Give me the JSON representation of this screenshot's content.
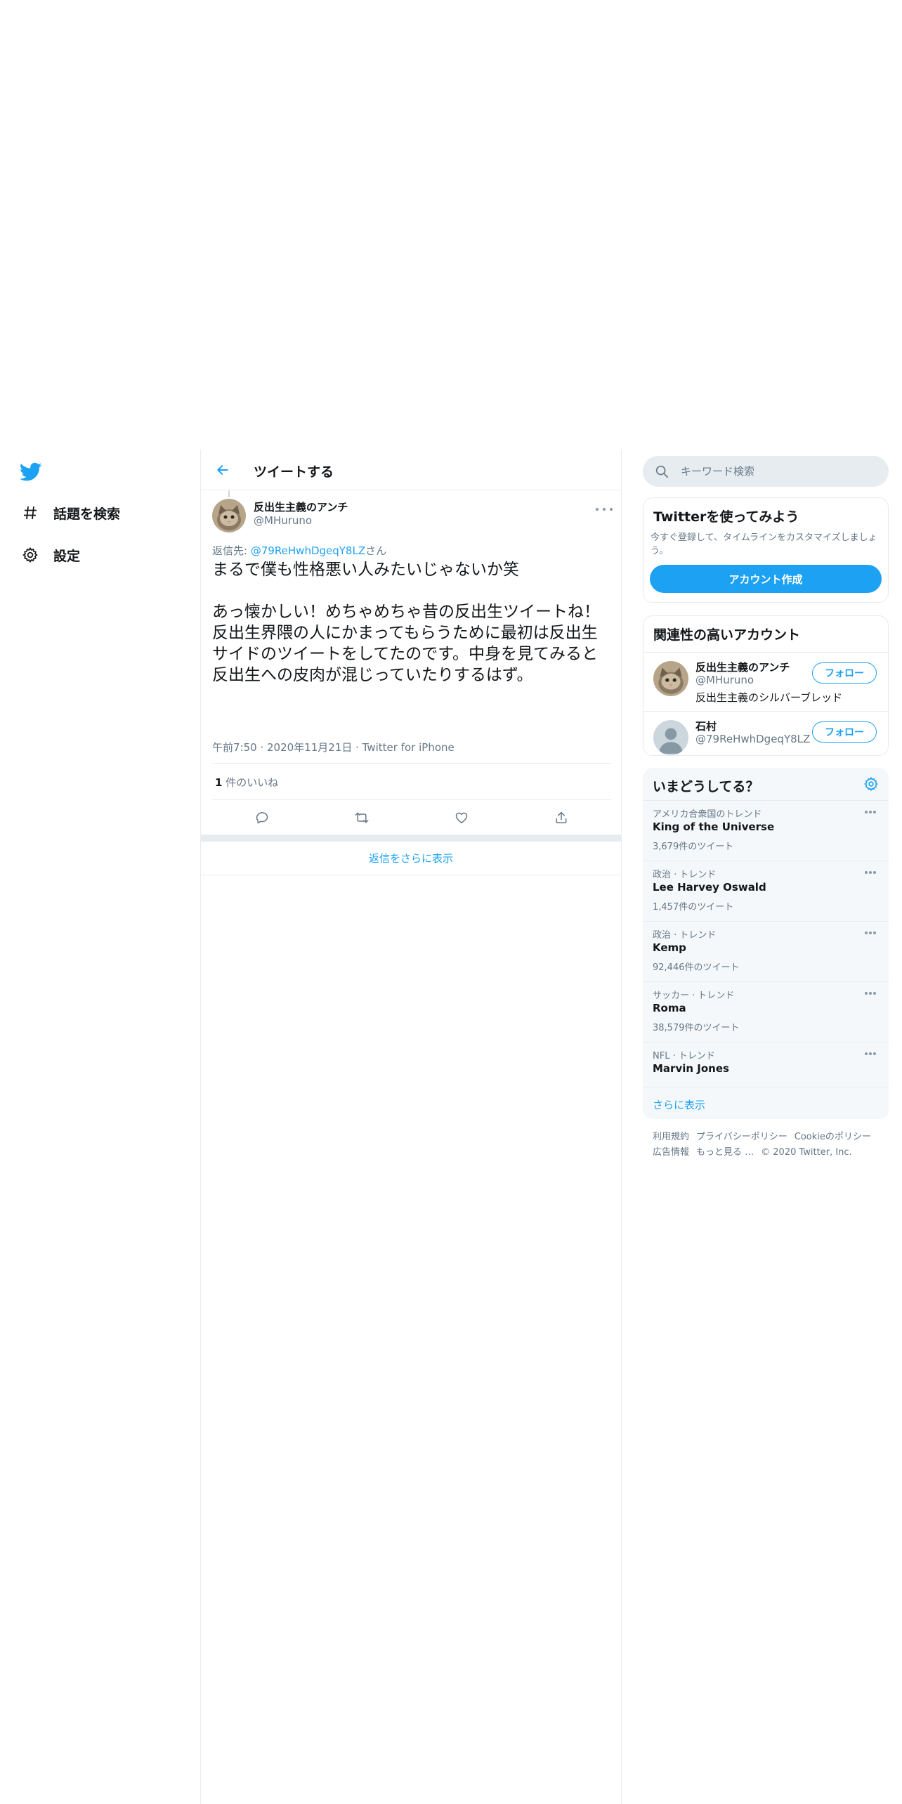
{
  "nav": {
    "logo": "twitter-bird-icon",
    "items": [
      {
        "label": "話題を検索",
        "icon": "hashtag-icon"
      },
      {
        "label": "設定",
        "icon": "gear-icon"
      }
    ]
  },
  "header": {
    "title": "ツイートする"
  },
  "tweet": {
    "author_name": "反出生主義のアンチ",
    "author_handle": "@MHuruno",
    "reply_prefix": "返信先: ",
    "reply_to": "@79ReHwhDgeqY8LZ",
    "reply_suffix": "さん",
    "text": "まるで僕も性格悪い人みたいじゃないか笑\n\nあっ懐かしい！めちゃめちゃ昔の反出生ツイートね！反出生界隈の人にかまってもらうために最初は反出生サイドのツイートをしてたのです。中身を見てみると反出生への皮肉が混じっていたりするはず。",
    "time": "午前7:50",
    "date": "2020年11月21日",
    "source": "Twitter for iPhone",
    "likes_count": "1",
    "likes_label": " 件のいいね",
    "actions": [
      "reply-icon",
      "retweet-icon",
      "like-icon",
      "share-icon"
    ],
    "show_more_replies": "返信をさらに表示"
  },
  "search": {
    "placeholder": "キーワード検索"
  },
  "signup": {
    "title": "Twitterを使ってみよう",
    "desc": "今すぐ登録して、タイムラインをカスタマイズしましょう。",
    "button": "アカウント作成"
  },
  "related": {
    "title": "関連性の高いアカウント",
    "accounts": [
      {
        "name": "反出生主義のアンチ",
        "handle": "@MHuruno",
        "bio": "反出生主義のシルバーブレッド",
        "follow": "フォロー"
      },
      {
        "name": "石村",
        "handle": "@79ReHwhDgeqY8LZ",
        "bio": "",
        "follow": "フォロー"
      }
    ]
  },
  "trends": {
    "title": "いまどうしてる？",
    "items": [
      {
        "context": "アメリカ合衆国のトレンド",
        "name": "King of the Universe",
        "count": "3,679件のツイート"
      },
      {
        "context": "政治 · トレンド",
        "name": "Lee Harvey Oswald",
        "count": "1,457件のツイート"
      },
      {
        "context": "政治 · トレンド",
        "name": "Kemp",
        "count": "92,446件のツイート"
      },
      {
        "context": "サッカー · トレンド",
        "name": "Roma",
        "count": "38,579件のツイート"
      },
      {
        "context": "NFL · トレンド",
        "name": "Marvin Jones",
        "count": ""
      }
    ],
    "show_more": "さらに表示"
  },
  "footer": {
    "links": [
      "利用規約",
      "プライバシーポリシー",
      "Cookieのポリシー",
      "広告情報",
      "もっと見る …"
    ],
    "copyright": "© 2020 Twitter, Inc."
  },
  "colors": {
    "accent": "#1da1f2",
    "text": "#14171a",
    "muted": "#657786",
    "border": "#e6ecf0"
  }
}
